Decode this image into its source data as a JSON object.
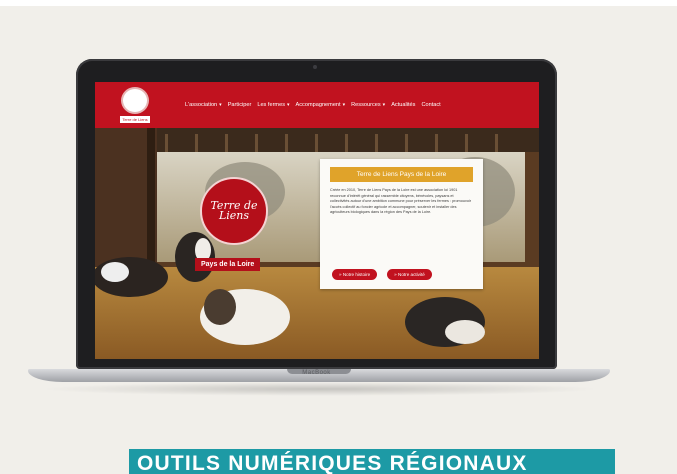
{
  "site": {
    "logo_tag": "Terre de Liens",
    "nav": [
      {
        "label": "L'association",
        "dropdown": true
      },
      {
        "label": "Participer",
        "dropdown": false
      },
      {
        "label": "Les fermes",
        "dropdown": true
      },
      {
        "label": "Accompagnement",
        "dropdown": true
      },
      {
        "label": "Ressources",
        "dropdown": true
      },
      {
        "label": "Actualités",
        "dropdown": false
      },
      {
        "label": "Contact",
        "dropdown": false
      }
    ],
    "hero_logo_text": "Terre de Liens",
    "region_label": "Pays de la Loire",
    "card": {
      "title": "Terre de Liens Pays de la Loire",
      "text": "Créée en 2010, Terre de Liens Pays de la Loire est une association loi 1901 reconnue d'intérêt général qui rassemble citoyens, bénévoles, paysans et collectivités autour d'une ambition commune pour préserver les fermes : promouvoir l'accès collectif au foncier agricole et accompagner, soutenir et installer des agriculteurs biologiques dans la région des Pays de la Loire.",
      "btn_history": "Notre histoire",
      "btn_activity": "Notre activité"
    }
  },
  "device_brand": "MacBook",
  "caption": "OUTILS NUMÉRIQUES RÉGIONAUX",
  "colors": {
    "brand_red": "#c1121f",
    "card_gold": "#e0a32a",
    "caption_teal": "#1d9aa5",
    "page_bg": "#f1efea"
  }
}
